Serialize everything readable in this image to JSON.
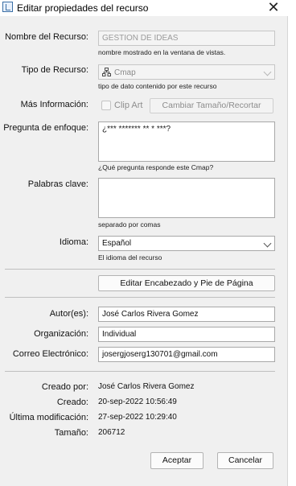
{
  "window": {
    "title": "Editar propiedades del recurso",
    "close": "✕"
  },
  "resource_name": {
    "label": "Nombre del Recurso:",
    "value": "GESTION DE IDEAS",
    "hint": "nombre mostrado en la ventana de vistas."
  },
  "resource_type": {
    "label": "Tipo de Recurso:",
    "value": "Cmap",
    "hint": "tipo de dato contenido por este recurso"
  },
  "more_info": {
    "label": "Más Información:",
    "clip_art_label": "Clip Art",
    "resize_button": "Cambiar Tamaño/Recortar"
  },
  "focus_question": {
    "label": "Pregunta de enfoque:",
    "value": "¿*** ******* ** *  ***?",
    "hint": "¿Qué pregunta responde este Cmap?"
  },
  "keywords": {
    "label": "Palabras clave:",
    "value": "",
    "hint": "separado por comas"
  },
  "language": {
    "label": "Idioma:",
    "value": "Español",
    "hint": "El idioma del recurso"
  },
  "header_footer_button": "Editar Encabezado y Pie de Página",
  "author": {
    "label": "Autor(es):",
    "value": "José Carlos Rivera Gomez"
  },
  "organization": {
    "label": "Organización:",
    "value": "Individual"
  },
  "email": {
    "label": "Correo Electrónico:",
    "value": "josergjoserg130701@gmail.com"
  },
  "info": {
    "created_by": {
      "label": "Creado por:",
      "value": "José Carlos Rivera Gomez"
    },
    "created": {
      "label": "Creado:",
      "value": "20-sep-2022 10:56:49"
    },
    "modified": {
      "label": "Última modificación:",
      "value": "27-sep-2022 10:29:40"
    },
    "size": {
      "label": "Tamaño:",
      "value": "206712"
    }
  },
  "buttons": {
    "accept": "Aceptar",
    "cancel": "Cancelar"
  },
  "colors": {
    "dialog_bg": "#f0f0f0",
    "field_border": "#a8a8a8",
    "disabled_text": "#9a9a9a"
  }
}
